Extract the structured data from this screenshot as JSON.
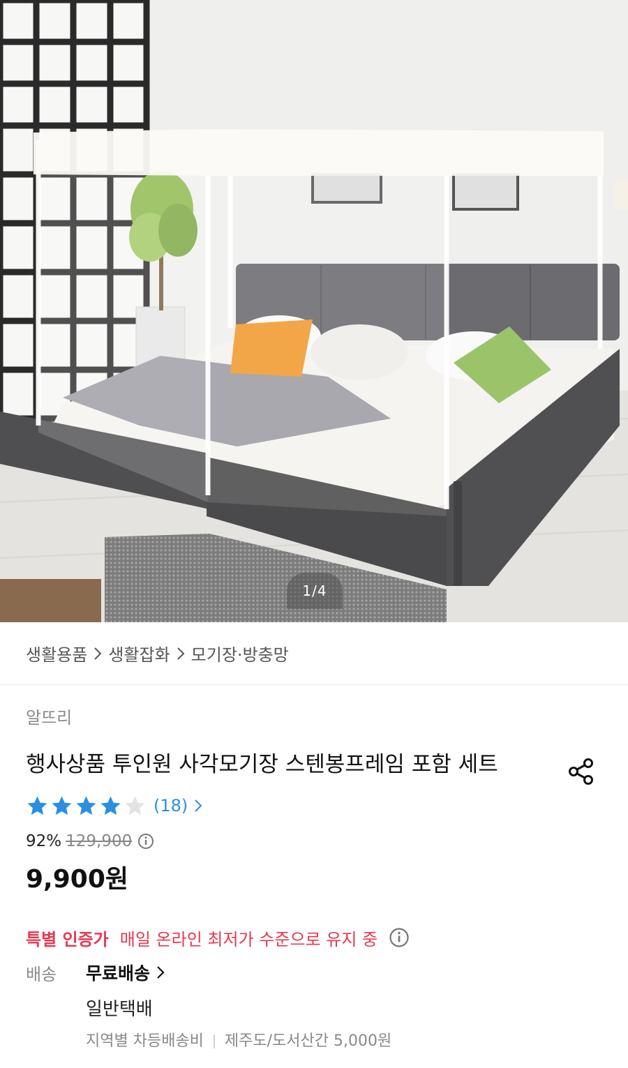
{
  "hero": {
    "page_indicator": "1/4"
  },
  "breadcrumb": [
    "생활용품",
    "생활잡화",
    "모기장·방충망"
  ],
  "product": {
    "seller": "알뜨리",
    "title": "행사상품 투인원 사각모기장 스텐봉프레임 포함 세트",
    "rating": {
      "stars": 4,
      "max_stars": 5,
      "review_count": "(18)"
    },
    "discount_rate": "92%",
    "original_price": "129,900",
    "price": "9,900원"
  },
  "special": {
    "label": "특별 인증가",
    "desc": "매일 온라인 최저가 수준으로 유지 중"
  },
  "shipping": {
    "label": "배송",
    "value": "무료배송",
    "method": "일반택배",
    "regional_fee_label": "지역별 차등배송비",
    "regional_fee_detail": "제주도/도서산간 5,000원"
  },
  "colors": {
    "star_filled": "#2b8fe0",
    "star_empty": "#e3e3e3",
    "special_red": "#e8384f",
    "link_blue": "#2b8fe0"
  },
  "icons": [
    "share-icon",
    "star-icon",
    "info-icon",
    "chevron-right-icon"
  ]
}
